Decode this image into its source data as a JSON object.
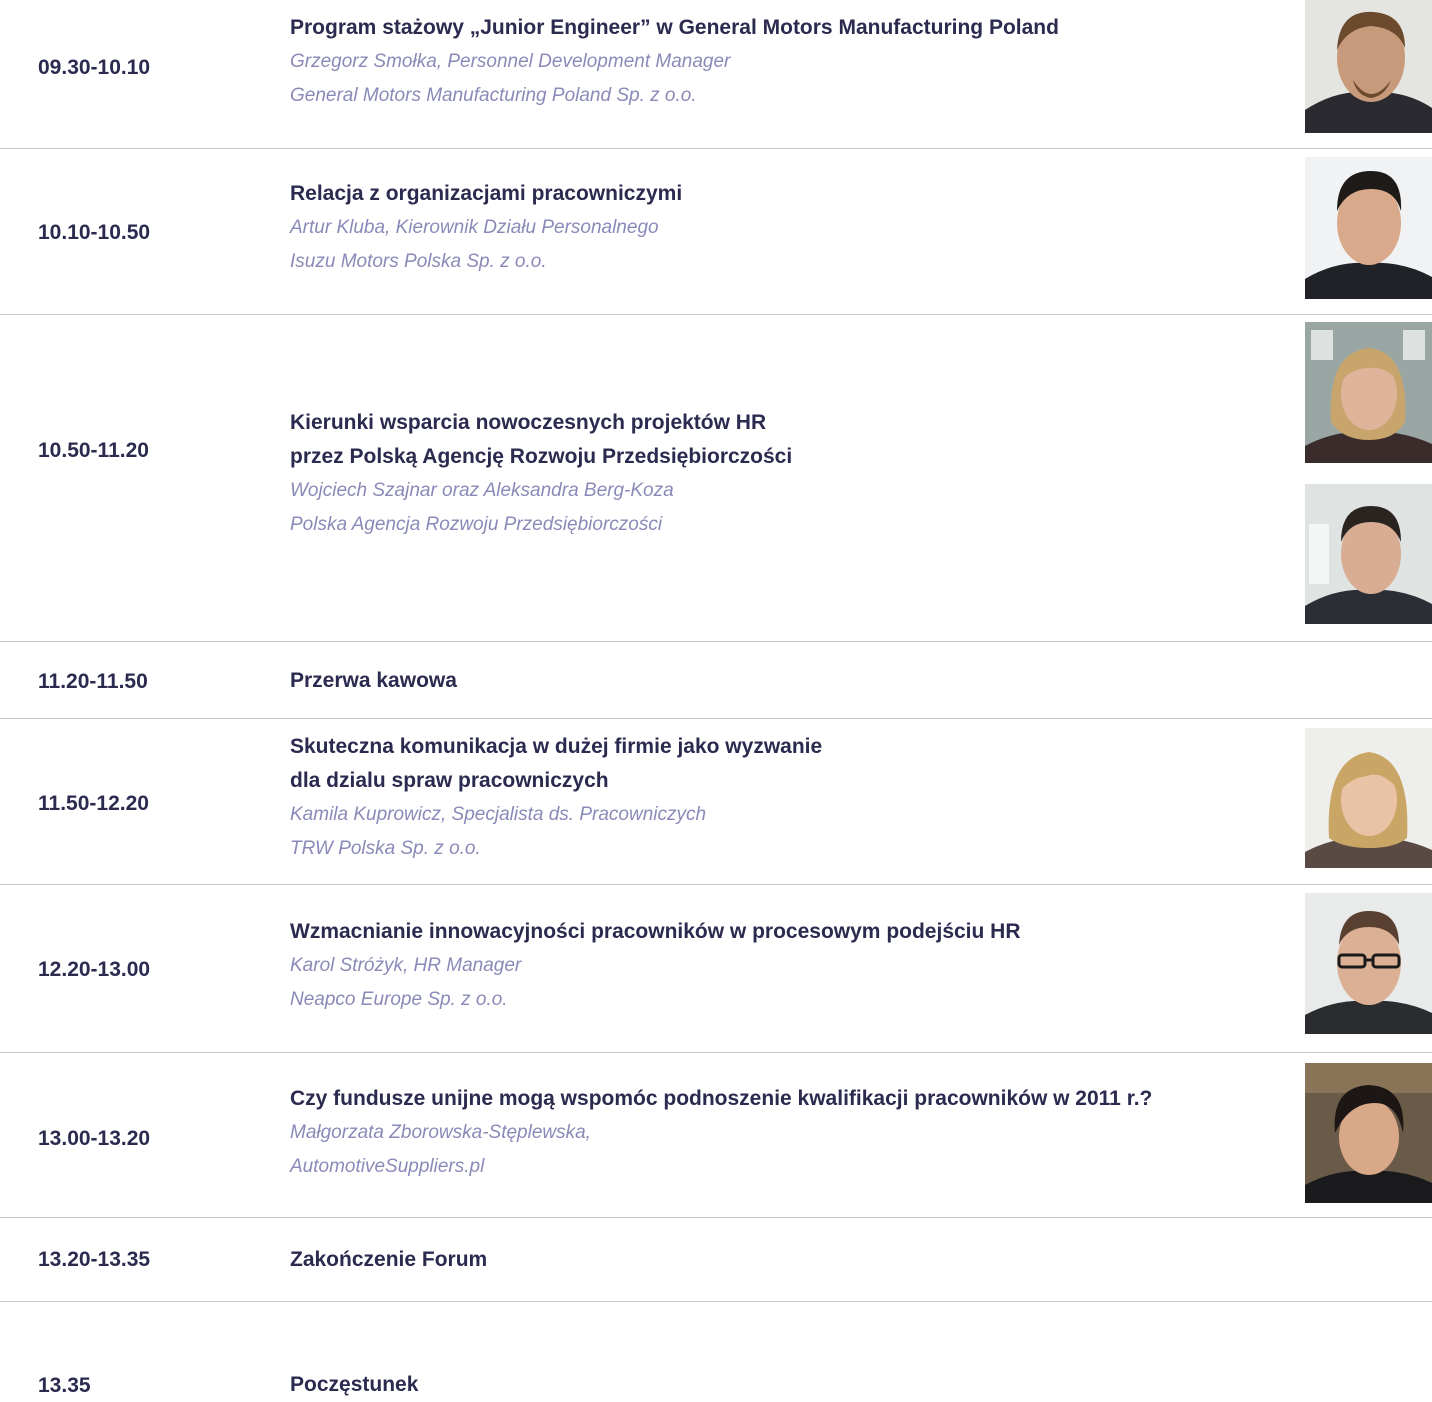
{
  "agenda": [
    {
      "time": "09.30-10.10",
      "title_lines": [
        "Program stażowy „Junior Engineer” w General Motors Manufacturing Poland"
      ],
      "speaker_lines": [
        "Grzegorz Smołka, Personnel Development Manager",
        "General Motors Manufacturing Poland Sp. z o.o."
      ]
    },
    {
      "time": "10.10-10.50",
      "title_lines": [
        "Relacja z organizacjami pracowniczymi"
      ],
      "speaker_lines": [
        "Artur Kluba, Kierownik Działu Personalnego",
        "Isuzu Motors Polska Sp. z o.o."
      ]
    },
    {
      "time": "10.50-11.20",
      "title_lines": [
        "Kierunki wsparcia nowoczesnych projektów HR",
        "przez Polską Agencję Rozwoju Przedsiębiorczości"
      ],
      "speaker_lines": [
        "Wojciech Szajnar oraz Aleksandra Berg-Koza",
        "Polska Agencja Rozwoju Przedsiębiorczości"
      ]
    },
    {
      "time": "11.20-11.50",
      "title_lines": [
        "Przerwa kawowa"
      ],
      "speaker_lines": []
    },
    {
      "time": "11.50-12.20",
      "title_lines": [
        "Skuteczna komunikacja w dużej firmie jako wyzwanie",
        "dla dzialu spraw pracowniczych"
      ],
      "speaker_lines": [
        "Kamila Kuprowicz, Specjalista ds. Pracowniczych",
        "TRW Polska Sp. z o.o."
      ]
    },
    {
      "time": "12.20-13.00",
      "title_lines": [
        "Wzmacnianie innowacyjności pracowników w procesowym podejściu HR"
      ],
      "speaker_lines": [
        "Karol Stróżyk, HR Manager",
        "Neapco Europe Sp. z o.o."
      ]
    },
    {
      "time": "13.00-13.20",
      "title_lines": [
        "Czy fundusze unijne mogą wspomóc podnoszenie kwalifikacji pracowników w 2011 r.?"
      ],
      "speaker_lines": [
        "Małgorzata Zborowska-Stęplewska,",
        "AutomotiveSuppliers.pl"
      ]
    },
    {
      "time": "13.20-13.35",
      "title_lines": [
        "Zakończenie Forum"
      ],
      "speaker_lines": []
    },
    {
      "time": "13.35",
      "title_lines": [
        "Poczęstunek"
      ],
      "speaker_lines": []
    }
  ],
  "photos": [
    {
      "name": "speaker-photo-smolka",
      "bg": "#e4e4e0",
      "skin": "#c89a7c",
      "hair": "#6b4a2e",
      "suit": "#2a2a30"
    },
    {
      "name": "speaker-photo-kluba",
      "bg": "#f1f2f4",
      "skin": "#d9a98c",
      "hair": "#1d1a18",
      "suit": "#202228"
    },
    {
      "name": "speaker-photo-berg-koza",
      "bg": "#9aa6a4",
      "skin": "#e0b49a",
      "hair": "#c7a56c",
      "suit": "#3a2c2a"
    },
    {
      "name": "speaker-photo-szajnar",
      "bg": "#dfe3e2",
      "skin": "#d8ad94",
      "hair": "#2a2420",
      "suit": "#2c2e36"
    },
    {
      "name": "speaker-photo-kuprowicz",
      "bg": "#eeeeea",
      "skin": "#e9c3a6",
      "hair": "#c9a566",
      "suit": "#5a4a44"
    },
    {
      "name": "speaker-photo-strozyk",
      "bg": "#e8ebea",
      "skin": "#dcb095",
      "hair": "#5a4030",
      "suit": "#2b2c30"
    },
    {
      "name": "speaker-photo-zborowska",
      "bg": "#6a5a48",
      "skin": "#d8a888",
      "hair": "#1c1614",
      "suit": "#1a1a1c"
    }
  ]
}
